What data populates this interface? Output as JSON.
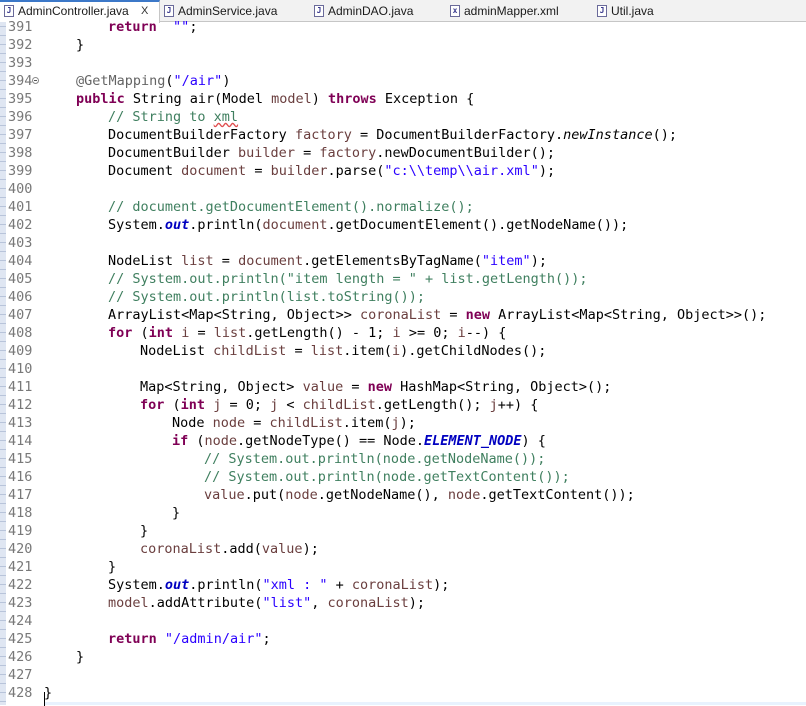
{
  "tabs": [
    {
      "label": "AdminController.java",
      "active": true,
      "icon": "java-file-icon",
      "close": "X"
    },
    {
      "label": "AdminService.java",
      "active": false,
      "icon": "java-file-icon"
    },
    {
      "label": "AdminDAO.java",
      "active": false,
      "icon": "java-file-icon"
    },
    {
      "label": "adminMapper.xml",
      "active": false,
      "icon": "xml-file-icon"
    },
    {
      "label": "Util.java",
      "active": false,
      "icon": "java-file-icon"
    }
  ],
  "colors": {
    "keyword": "#7f0055",
    "string": "#2a00ff",
    "comment": "#3f7f5f",
    "annotation": "#646464",
    "variable": "#6a3e3e",
    "field": "#0000c0"
  },
  "lines": [
    {
      "n": "391",
      "indent": 2,
      "t": [
        [
          "k",
          "return"
        ],
        [
          "",
          "  "
        ],
        [
          "s",
          "\"\""
        ],
        [
          "",
          ";"
        ]
      ]
    },
    {
      "n": "392",
      "indent": 1,
      "t": [
        [
          "",
          "}"
        ]
      ]
    },
    {
      "n": "393",
      "indent": 0,
      "t": []
    },
    {
      "n": "394",
      "indent": 1,
      "fold": true,
      "t": [
        [
          "a",
          "@GetMapping"
        ],
        [
          "",
          "("
        ],
        [
          "s",
          "\"/air\""
        ],
        [
          "",
          ")"
        ]
      ]
    },
    {
      "n": "395",
      "indent": 1,
      "t": [
        [
          "k",
          "public"
        ],
        [
          "",
          " String air(Model "
        ],
        [
          "v",
          "model"
        ],
        [
          "",
          ") "
        ],
        [
          "k",
          "throws"
        ],
        [
          "",
          " Exception {"
        ]
      ]
    },
    {
      "n": "396",
      "indent": 2,
      "t": [
        [
          "c",
          "// String to "
        ],
        [
          "csq",
          "xml"
        ]
      ]
    },
    {
      "n": "397",
      "indent": 2,
      "t": [
        [
          "",
          "DocumentBuilderFactory "
        ],
        [
          "v",
          "factory"
        ],
        [
          "",
          " = DocumentBuilderFactory."
        ],
        [
          "sm",
          "newInstance"
        ],
        [
          "",
          "();"
        ]
      ]
    },
    {
      "n": "398",
      "indent": 2,
      "t": [
        [
          "",
          "DocumentBuilder "
        ],
        [
          "v",
          "builder"
        ],
        [
          "",
          " = "
        ],
        [
          "v",
          "factory"
        ],
        [
          "",
          ".newDocumentBuilder();"
        ]
      ]
    },
    {
      "n": "399",
      "indent": 2,
      "t": [
        [
          "",
          "Document "
        ],
        [
          "v",
          "document"
        ],
        [
          "",
          " = "
        ],
        [
          "v",
          "builder"
        ],
        [
          "",
          ".parse("
        ],
        [
          "s",
          "\"c:\\\\temp\\\\air.xml\""
        ],
        [
          "",
          ");"
        ]
      ]
    },
    {
      "n": "400",
      "indent": 0,
      "t": []
    },
    {
      "n": "401",
      "indent": 2,
      "t": [
        [
          "c",
          "// document.getDocumentElement().normalize();"
        ]
      ]
    },
    {
      "n": "402",
      "indent": 2,
      "t": [
        [
          "",
          "System."
        ],
        [
          "sf",
          "out"
        ],
        [
          "",
          ".println("
        ],
        [
          "v",
          "document"
        ],
        [
          "",
          ".getDocumentElement().getNodeName());"
        ]
      ]
    },
    {
      "n": "403",
      "indent": 0,
      "t": []
    },
    {
      "n": "404",
      "indent": 2,
      "t": [
        [
          "",
          "NodeList "
        ],
        [
          "v",
          "list"
        ],
        [
          "",
          " = "
        ],
        [
          "v",
          "document"
        ],
        [
          "",
          ".getElementsByTagName("
        ],
        [
          "s",
          "\"item\""
        ],
        [
          "",
          ");"
        ]
      ]
    },
    {
      "n": "405",
      "indent": 2,
      "t": [
        [
          "c",
          "// System.out.println(\"item length = \" + list.getLength());"
        ]
      ]
    },
    {
      "n": "406",
      "indent": 2,
      "t": [
        [
          "c",
          "// System.out.println(list.toString());"
        ]
      ]
    },
    {
      "n": "407",
      "indent": 2,
      "t": [
        [
          "",
          "ArrayList<Map<String, Object>> "
        ],
        [
          "v",
          "coronaList"
        ],
        [
          "",
          " = "
        ],
        [
          "k",
          "new"
        ],
        [
          "",
          " ArrayList<Map<String, Object>>();"
        ]
      ]
    },
    {
      "n": "408",
      "indent": 2,
      "t": [
        [
          "k",
          "for"
        ],
        [
          "",
          " ("
        ],
        [
          "k",
          "int"
        ],
        [
          "",
          " "
        ],
        [
          "v",
          "i"
        ],
        [
          "",
          " = "
        ],
        [
          "v",
          "list"
        ],
        [
          "",
          ".getLength() - 1; "
        ],
        [
          "v",
          "i"
        ],
        [
          "",
          " >= 0; "
        ],
        [
          "v",
          "i"
        ],
        [
          "",
          "--) {"
        ]
      ]
    },
    {
      "n": "409",
      "indent": 3,
      "t": [
        [
          "",
          "NodeList "
        ],
        [
          "v",
          "childList"
        ],
        [
          "",
          " = "
        ],
        [
          "v",
          "list"
        ],
        [
          "",
          ".item("
        ],
        [
          "v",
          "i"
        ],
        [
          "",
          ").getChildNodes();"
        ]
      ]
    },
    {
      "n": "410",
      "indent": 0,
      "t": []
    },
    {
      "n": "411",
      "indent": 3,
      "t": [
        [
          "",
          "Map<String, Object> "
        ],
        [
          "v",
          "value"
        ],
        [
          "",
          " = "
        ],
        [
          "k",
          "new"
        ],
        [
          "",
          " HashMap<String, Object>();"
        ]
      ]
    },
    {
      "n": "412",
      "indent": 3,
      "t": [
        [
          "k",
          "for"
        ],
        [
          "",
          " ("
        ],
        [
          "k",
          "int"
        ],
        [
          "",
          " "
        ],
        [
          "v",
          "j"
        ],
        [
          "",
          " = 0; "
        ],
        [
          "v",
          "j"
        ],
        [
          "",
          " < "
        ],
        [
          "v",
          "childList"
        ],
        [
          "",
          ".getLength(); "
        ],
        [
          "v",
          "j"
        ],
        [
          "",
          "++) {"
        ]
      ]
    },
    {
      "n": "413",
      "indent": 4,
      "t": [
        [
          "",
          "Node "
        ],
        [
          "v",
          "node"
        ],
        [
          "",
          " = "
        ],
        [
          "v",
          "childList"
        ],
        [
          "",
          ".item("
        ],
        [
          "v",
          "j"
        ],
        [
          "",
          ");"
        ]
      ]
    },
    {
      "n": "414",
      "indent": 4,
      "t": [
        [
          "k",
          "if"
        ],
        [
          "",
          " ("
        ],
        [
          "v",
          "node"
        ],
        [
          "",
          ".getNodeType() == Node."
        ],
        [
          "fi",
          "ELEMENT_NODE"
        ],
        [
          "",
          ") {"
        ]
      ]
    },
    {
      "n": "415",
      "indent": 5,
      "t": [
        [
          "c",
          "// System.out.println(node.getNodeName());"
        ]
      ]
    },
    {
      "n": "416",
      "indent": 5,
      "t": [
        [
          "c",
          "// System.out.println(node.getTextContent());"
        ]
      ]
    },
    {
      "n": "417",
      "indent": 5,
      "t": [
        [
          "v",
          "value"
        ],
        [
          "",
          ".put("
        ],
        [
          "v",
          "node"
        ],
        [
          "",
          ".getNodeName(), "
        ],
        [
          "v",
          "node"
        ],
        [
          "",
          ".getTextContent());"
        ]
      ]
    },
    {
      "n": "418",
      "indent": 4,
      "t": [
        [
          "",
          "}"
        ]
      ]
    },
    {
      "n": "419",
      "indent": 3,
      "t": [
        [
          "",
          "}"
        ]
      ]
    },
    {
      "n": "420",
      "indent": 3,
      "t": [
        [
          "v",
          "coronaList"
        ],
        [
          "",
          ".add("
        ],
        [
          "v",
          "value"
        ],
        [
          "",
          ");"
        ]
      ]
    },
    {
      "n": "421",
      "indent": 2,
      "t": [
        [
          "",
          "}"
        ]
      ]
    },
    {
      "n": "422",
      "indent": 2,
      "t": [
        [
          "",
          "System."
        ],
        [
          "sf",
          "out"
        ],
        [
          "",
          ".println("
        ],
        [
          "s",
          "\"xml : \""
        ],
        [
          "",
          " + "
        ],
        [
          "v",
          "coronaList"
        ],
        [
          "",
          ");"
        ]
      ]
    },
    {
      "n": "423",
      "indent": 2,
      "t": [
        [
          "v",
          "model"
        ],
        [
          "",
          ".addAttribute("
        ],
        [
          "s",
          "\"list\""
        ],
        [
          "",
          ", "
        ],
        [
          "v",
          "coronaList"
        ],
        [
          "",
          ");"
        ]
      ]
    },
    {
      "n": "424",
      "indent": 0,
      "t": []
    },
    {
      "n": "425",
      "indent": 2,
      "t": [
        [
          "k",
          "return"
        ],
        [
          "",
          " "
        ],
        [
          "s",
          "\"/admin/air\""
        ],
        [
          "",
          ";"
        ]
      ]
    },
    {
      "n": "426",
      "indent": 1,
      "t": [
        [
          "",
          "}"
        ]
      ]
    },
    {
      "n": "427",
      "indent": 0,
      "t": []
    },
    {
      "n": "428",
      "indent": 0,
      "t": [
        [
          "",
          "}"
        ]
      ]
    }
  ]
}
